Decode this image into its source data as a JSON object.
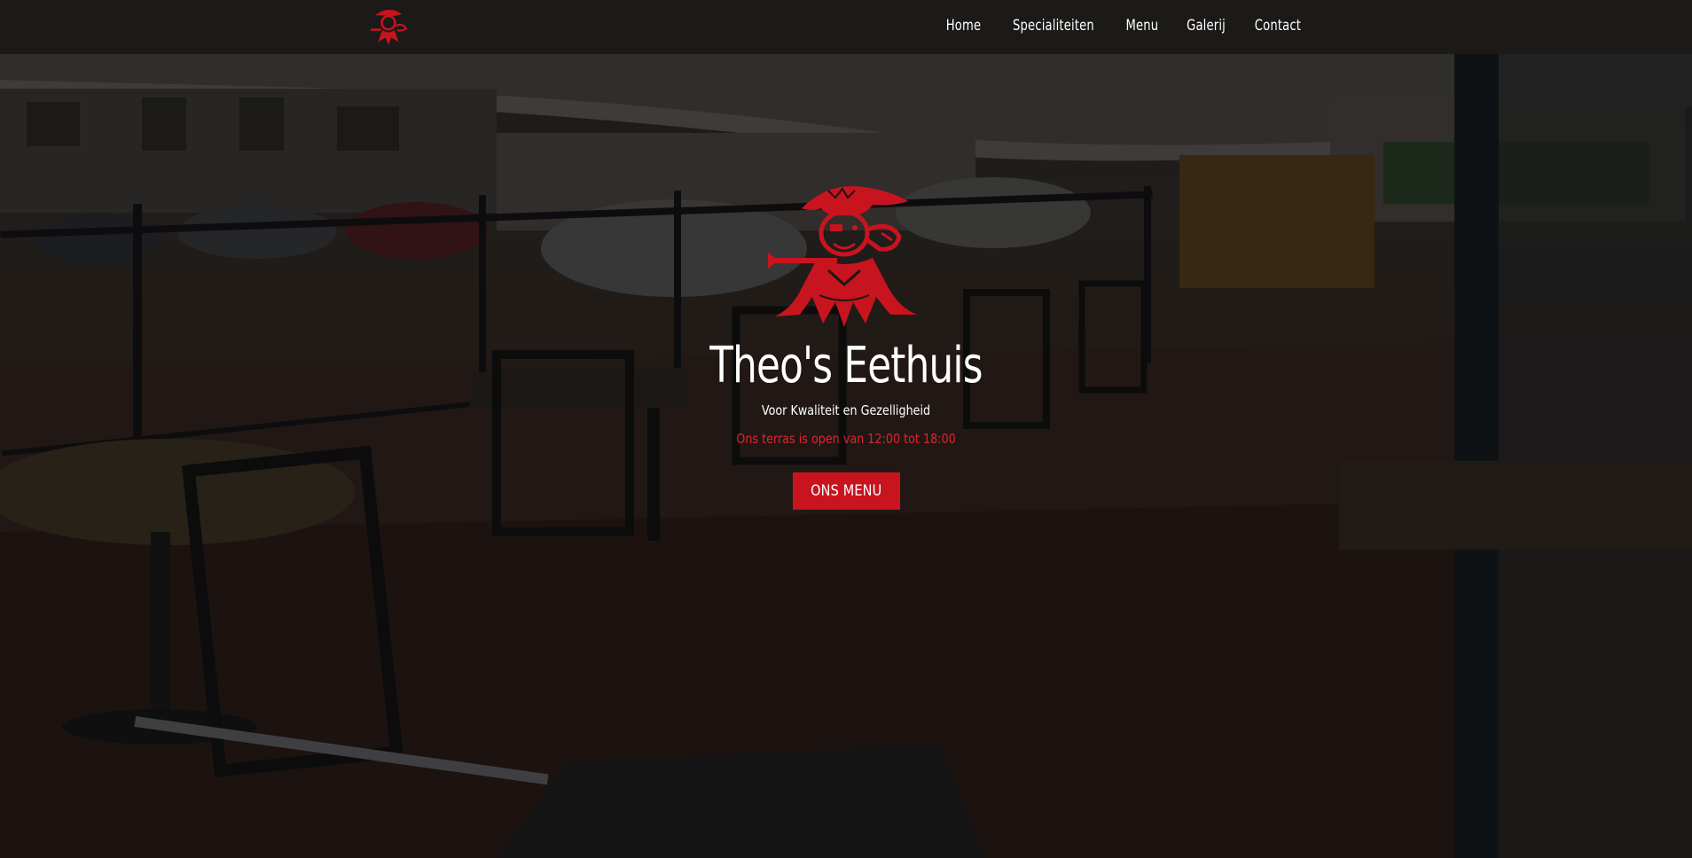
{
  "nav": {
    "logo_icon": "pirate-chef-logo-icon",
    "items": [
      {
        "label": "Home"
      },
      {
        "label": "Specialiteiten"
      },
      {
        "label": "Menu"
      },
      {
        "label": "Galerij"
      },
      {
        "label": "Contact"
      }
    ]
  },
  "hero": {
    "logo_icon": "pirate-chef-logo-icon",
    "title": "Theo's Eethuis",
    "tagline": "Voor Kwaliteit en Gezelligheid",
    "hours": "Ons terras is open van 12:00 tot 18:00",
    "button_label": "ONS MENU"
  },
  "colors": {
    "accent": "#c8141f",
    "hours_text": "#e0232e",
    "nav_bg": "#1c1a18",
    "text": "#ffffff"
  }
}
